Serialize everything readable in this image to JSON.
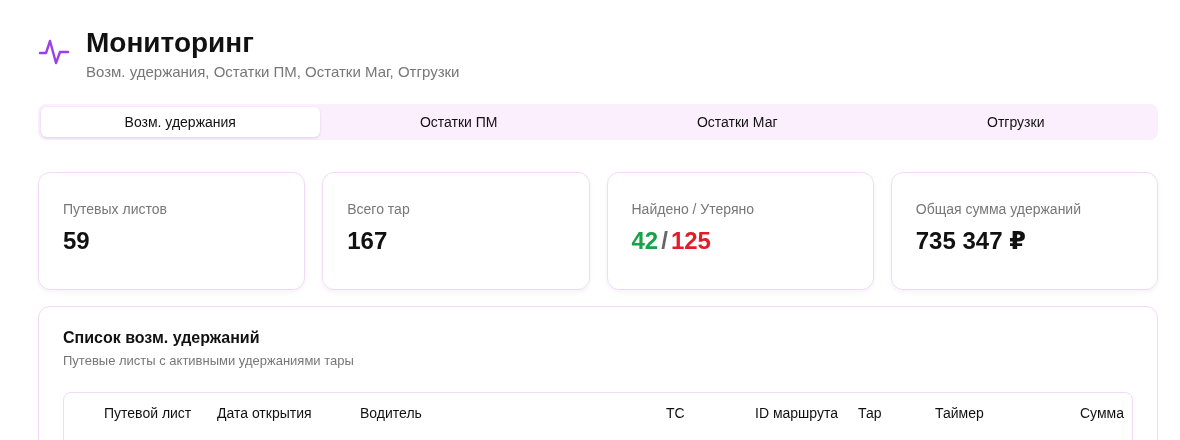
{
  "header": {
    "title": "Мониторинг",
    "subtitle": "Возм. удержания, Остатки ПМ, Остатки Маг, Отгрузки"
  },
  "tabs": [
    {
      "label": "Возм. удержания",
      "selected": true
    },
    {
      "label": "Остатки ПМ",
      "selected": false
    },
    {
      "label": "Остатки Маг",
      "selected": false
    },
    {
      "label": "Отгрузки",
      "selected": false
    }
  ],
  "stats": [
    {
      "kind": "plain",
      "label": "Путевых листов",
      "value": "59"
    },
    {
      "kind": "plain",
      "label": "Всего тар",
      "value": "167"
    },
    {
      "kind": "split",
      "label": "Найдено / Утеряно",
      "found": "42",
      "separator": "/",
      "lost": "125"
    },
    {
      "kind": "plain",
      "label": "Общая сумма удержаний",
      "value": "735 347 ₽"
    }
  ],
  "list": {
    "title": "Список возм. удержаний",
    "description": "Путевые листы с активными удержаниями тары",
    "columns": [
      "Путевой лист",
      "Дата открытия",
      "Водитель",
      "ТС",
      "ID маршрута",
      "Тар",
      "Таймер",
      "Сумма"
    ]
  }
}
